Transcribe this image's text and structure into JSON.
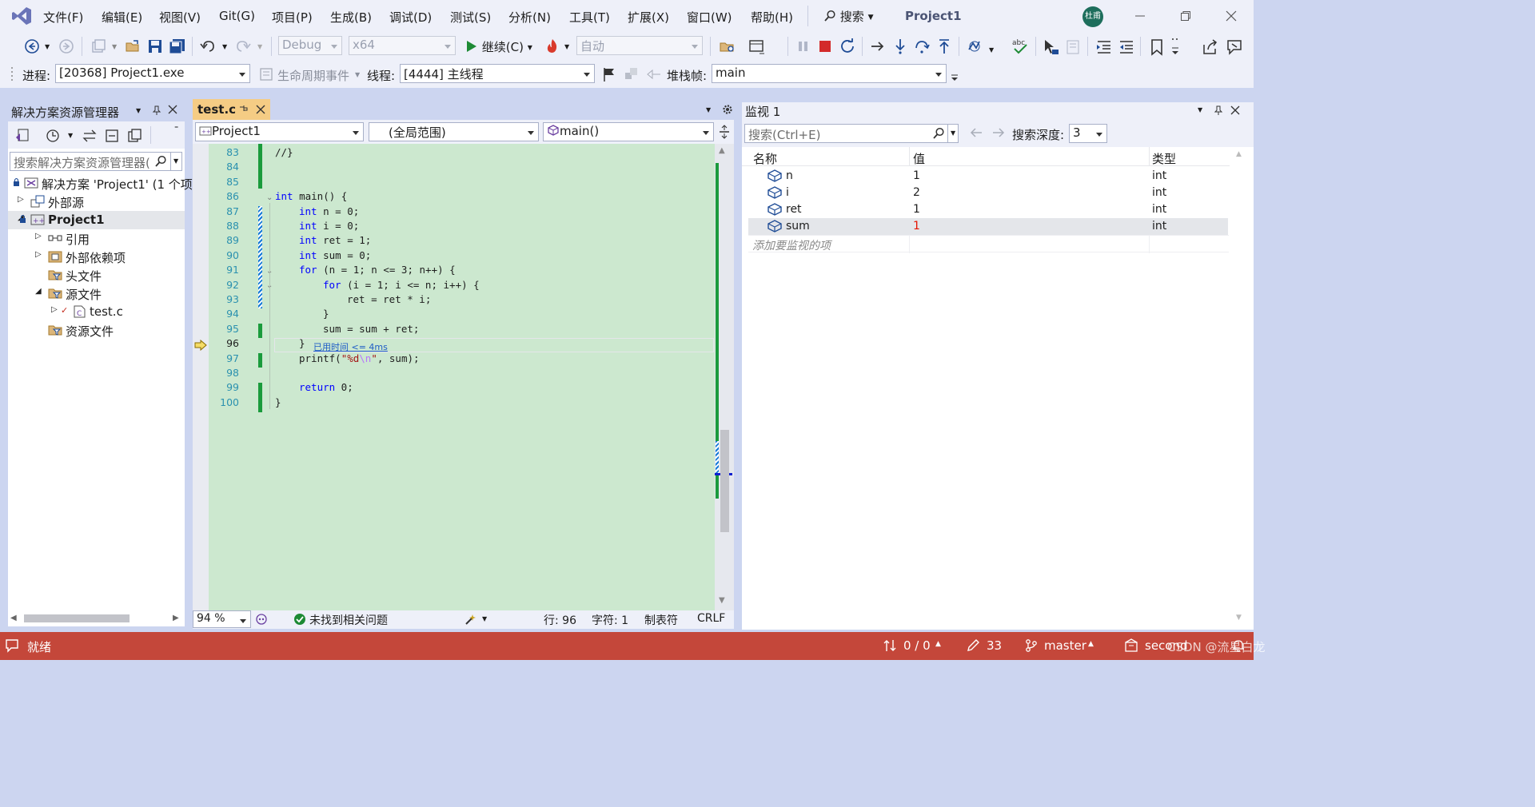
{
  "menu": [
    "文件(F)",
    "编辑(E)",
    "视图(V)",
    "Git(G)",
    "项目(P)",
    "生成(B)",
    "调试(D)",
    "测试(S)",
    "分析(N)",
    "工具(T)",
    "扩展(X)",
    "窗口(W)",
    "帮助(H)"
  ],
  "search_label": "搜索",
  "window_title": "Project1",
  "avatar_text": "杜甫",
  "toolbar1": {
    "config": "Debug",
    "platform": "x64",
    "continue_label": "继续(C)",
    "auto": "自动"
  },
  "toolbar2": {
    "process_label": "进程:",
    "process_value": "[20368] Project1.exe",
    "lifecycle_label": "生命周期事件",
    "thread_label": "线程:",
    "thread_value": "[4444] 主线程",
    "stackframe_label": "堆栈帧:",
    "stackframe_value": "main"
  },
  "solution_explorer": {
    "title": "解决方案资源管理器",
    "search_placeholder": "搜索解决方案资源管理器(",
    "items": [
      {
        "label": "解决方案 'Project1' (1 个项",
        "level": 0,
        "icon": "solution-icon",
        "arrow": "",
        "lock": true
      },
      {
        "label": "外部源",
        "level": 1,
        "icon": "external-source-icon",
        "arrow": "right",
        "lock": false
      },
      {
        "label": "Project1",
        "level": 1,
        "icon": "project-icon",
        "arrow": "down",
        "lock": true,
        "bold": true
      },
      {
        "label": "引用",
        "level": 2,
        "icon": "reference-icon",
        "arrow": "right",
        "lock": false
      },
      {
        "label": "外部依赖项",
        "level": 2,
        "icon": "dependency-icon",
        "arrow": "right",
        "lock": false
      },
      {
        "label": "头文件",
        "level": 2,
        "icon": "filter-folder-icon",
        "arrow": "",
        "lock": false
      },
      {
        "label": "源文件",
        "level": 2,
        "icon": "filter-folder-icon",
        "arrow": "down",
        "lock": false
      },
      {
        "label": "test.c",
        "level": 3,
        "icon": "c-file-icon",
        "arrow": "right",
        "lock": false,
        "check": true
      },
      {
        "label": "资源文件",
        "level": 2,
        "icon": "filter-folder-icon",
        "arrow": "",
        "lock": false
      }
    ]
  },
  "editor": {
    "tab_label": "test.c",
    "project_combo": "Project1",
    "scope_combo": "(全局范围)",
    "function_combo": "main()",
    "elapsed_hint": "已用时间 <= 4ms",
    "lines": [
      {
        "num": "83",
        "html": "//}",
        "indent": 0
      },
      {
        "num": "84",
        "html": "",
        "indent": 0
      },
      {
        "num": "85",
        "html": "",
        "indent": 0
      },
      {
        "num": "86",
        "html": "<span class='kw'>int</span> main() {",
        "indent": 0
      },
      {
        "num": "87",
        "html": "<span class='kw'>int</span> n = 0;",
        "indent": 1
      },
      {
        "num": "88",
        "html": "<span class='kw'>int</span> i = 0;",
        "indent": 1
      },
      {
        "num": "89",
        "html": "<span class='kw'>int</span> ret = 1;",
        "indent": 1
      },
      {
        "num": "90",
        "html": "<span class='kw'>int</span> sum = 0;",
        "indent": 1
      },
      {
        "num": "91",
        "html": "<span class='kw'>for</span> (n = 1; n &lt;= 3; n++) {",
        "indent": 1
      },
      {
        "num": "92",
        "html": "<span class='kw'>for</span> (i = 1; i &lt;= n; i++) {",
        "indent": 2
      },
      {
        "num": "93",
        "html": "ret = ret * i;",
        "indent": 3
      },
      {
        "num": "94",
        "html": "}",
        "indent": 2
      },
      {
        "num": "95",
        "html": "sum = sum + ret;",
        "indent": 2
      },
      {
        "num": "96",
        "html": "}",
        "indent": 1
      },
      {
        "num": "97",
        "html": "printf(<span class='str'>\"%d<span class='esc'>\\n</span>\"</span>, sum);",
        "indent": 1
      },
      {
        "num": "98",
        "html": "",
        "indent": 0
      },
      {
        "num": "99",
        "html": "<span class='kw'>return</span> 0;",
        "indent": 1
      },
      {
        "num": "100",
        "html": "}",
        "indent": 0
      }
    ],
    "current_line_number": "96",
    "zoom": "94 %",
    "issues": "未找到相关问题",
    "row_label": "行: 96",
    "char_label": "字符: 1",
    "tab_mode": "制表符",
    "line_ending": "CRLF"
  },
  "watch": {
    "title": "监视 1",
    "search_placeholder": "搜索(Ctrl+E)",
    "depth_label": "搜索深度:",
    "depth_value": "3",
    "columns": [
      "名称",
      "值",
      "类型"
    ],
    "rows": [
      {
        "name": "n",
        "value": "1",
        "type": "int",
        "changed": false
      },
      {
        "name": "i",
        "value": "2",
        "type": "int",
        "changed": false
      },
      {
        "name": "ret",
        "value": "1",
        "type": "int",
        "changed": false
      },
      {
        "name": "sum",
        "value": "1",
        "type": "int",
        "changed": true
      }
    ],
    "add_placeholder": "添加要监视的项"
  },
  "statusbar": {
    "ready": "就绪",
    "changes": "0 / 0",
    "edits": "33",
    "branch": "master",
    "repo": "second",
    "watermark": "CSDN @流星白龙"
  },
  "colors": {
    "accent_blue": "#1f4c96",
    "statusbar": "#c4473a",
    "editor_bg": "#cce8cf",
    "changed_value": "#e51400"
  }
}
